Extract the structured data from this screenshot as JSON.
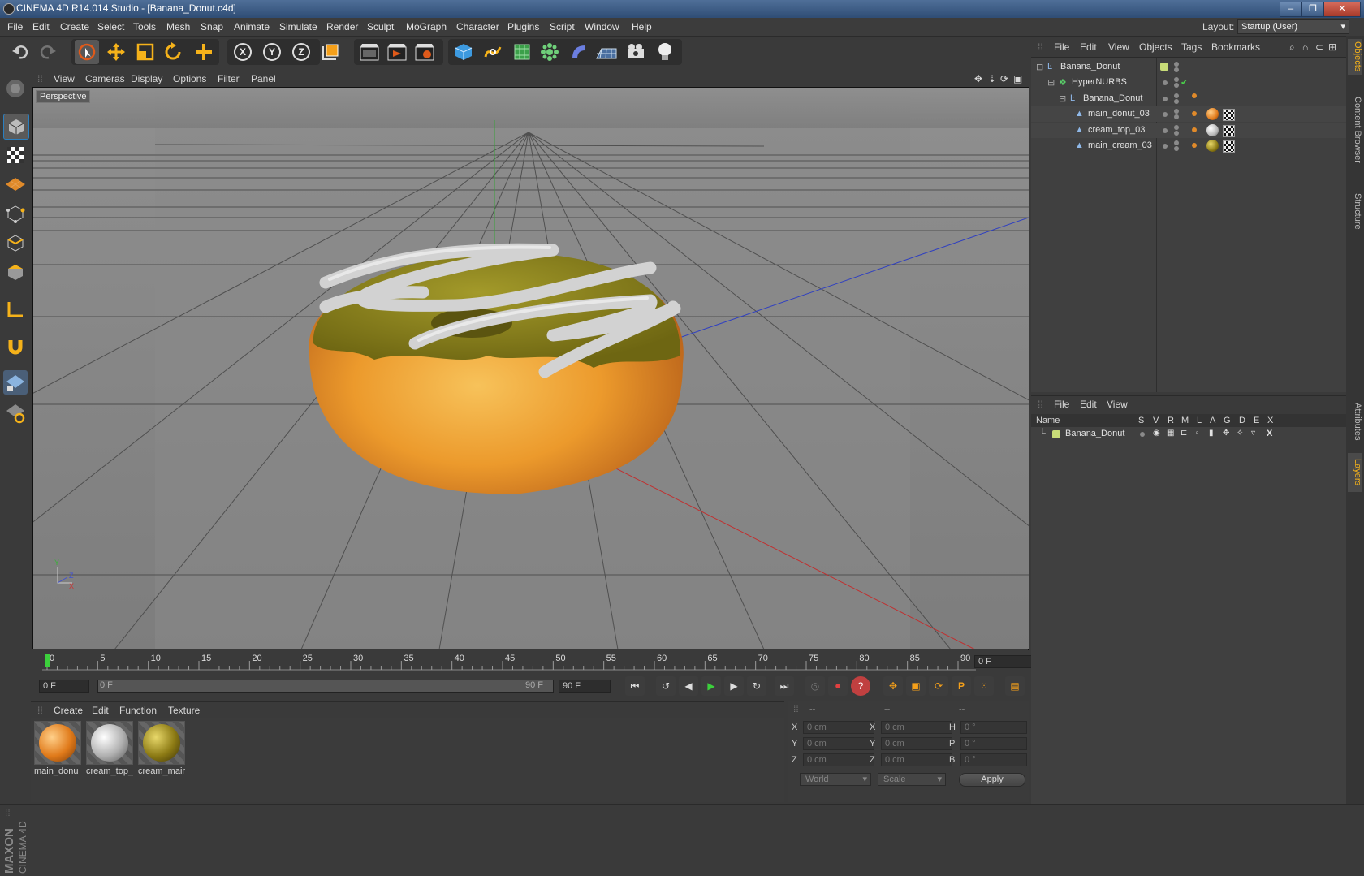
{
  "window": {
    "title": "CINEMA 4D R14.014 Studio - [Banana_Donut.c4d]",
    "buttons": [
      "–",
      "❐",
      "✕"
    ]
  },
  "menu": [
    "File",
    "Edit",
    "Create",
    "Select",
    "Tools",
    "Mesh",
    "Snap",
    "Animate",
    "Simulate",
    "Render",
    "Sculpt",
    "MoGraph",
    "Character",
    "Plugins",
    "Script",
    "Window",
    "Help"
  ],
  "layout": {
    "label": "Layout:",
    "value": "Startup (User)"
  },
  "toolbar": {
    "icons": [
      "undo-icon",
      "redo-icon",
      "live-selection-icon",
      "move-icon",
      "scale-icon",
      "rotate-icon",
      "create-object-icon",
      "x-axis-icon",
      "y-axis-icon",
      "z-axis-icon",
      "coordinate-system-icon",
      "render-view-icon",
      "render-picture-viewer-icon",
      "render-settings-icon",
      "cube-icon",
      "spline-icon",
      "nurbs-icon",
      "array-icon",
      "deformer-icon",
      "scene-icon",
      "camera-icon",
      "light-icon"
    ],
    "axis_labels": [
      "X",
      "Y",
      "Z"
    ]
  },
  "viewport": {
    "menu": [
      "View",
      "Cameras",
      "Display",
      "Options",
      "Filter",
      "Panel"
    ],
    "label": "Perspective",
    "axis_gizmo": [
      "Y",
      "Z",
      "X"
    ]
  },
  "timeline": {
    "ticks": [
      "0",
      "5",
      "10",
      "15",
      "20",
      "25",
      "30",
      "35",
      "40",
      "45",
      "50",
      "55",
      "60",
      "65",
      "70",
      "75",
      "80",
      "85",
      "90"
    ],
    "current_frame": "0 F",
    "start_field": "0 F",
    "range_start": "0 F",
    "range_end": "90 F",
    "end_field": "90 F"
  },
  "materials": {
    "menu": [
      "Create",
      "Edit",
      "Function",
      "Texture"
    ],
    "items": [
      {
        "name": "main_donu",
        "color": "#e07a1a"
      },
      {
        "name": "cream_top_",
        "color": "#b0b0b0"
      },
      {
        "name": "cream_mair",
        "color": "#8c7a14"
      }
    ]
  },
  "coordinates": {
    "headers": [
      "--",
      "--",
      "--"
    ],
    "rows": [
      {
        "a": "X",
        "av": "0 cm",
        "b": "X",
        "bv": "0 cm",
        "c": "H",
        "cv": "0 °"
      },
      {
        "a": "Y",
        "av": "0 cm",
        "b": "Y",
        "bv": "0 cm",
        "c": "P",
        "cv": "0 °"
      },
      {
        "a": "Z",
        "av": "0 cm",
        "b": "Z",
        "bv": "0 cm",
        "c": "B",
        "cv": "0 °"
      }
    ],
    "mode": "World",
    "transform": "Scale",
    "apply": "Apply"
  },
  "object_manager": {
    "menu": [
      "File",
      "Edit",
      "View",
      "Objects",
      "Tags",
      "Bookmarks"
    ],
    "objects": [
      {
        "name": "Banana_Donut",
        "indent": 0,
        "icon": "null-icon"
      },
      {
        "name": "HyperNURBS",
        "indent": 1,
        "icon": "hypernurbs-icon"
      },
      {
        "name": "Banana_Donut",
        "indent": 2,
        "icon": "null-icon"
      },
      {
        "name": "main_donut_03",
        "indent": 3,
        "icon": "polygon-icon",
        "tag": "#e07a1a"
      },
      {
        "name": "cream_top_03",
        "indent": 3,
        "icon": "polygon-icon",
        "tag": "#b8b8b8"
      },
      {
        "name": "main_cream_03",
        "indent": 3,
        "icon": "polygon-icon",
        "tag": "#8c7a14"
      }
    ]
  },
  "layer_manager": {
    "menu": [
      "File",
      "Edit",
      "View"
    ],
    "columns": [
      "Name",
      "S",
      "V",
      "R",
      "M",
      "L",
      "A",
      "G",
      "D",
      "E",
      "X"
    ],
    "layers": [
      {
        "name": "Banana_Donut",
        "color": "#c8dc78"
      }
    ]
  },
  "side_tabs": [
    "Objects",
    "Content Browser",
    "Structure",
    "Attributes",
    "Layers"
  ],
  "branding": [
    "MAXON",
    "CINEMA 4D"
  ]
}
